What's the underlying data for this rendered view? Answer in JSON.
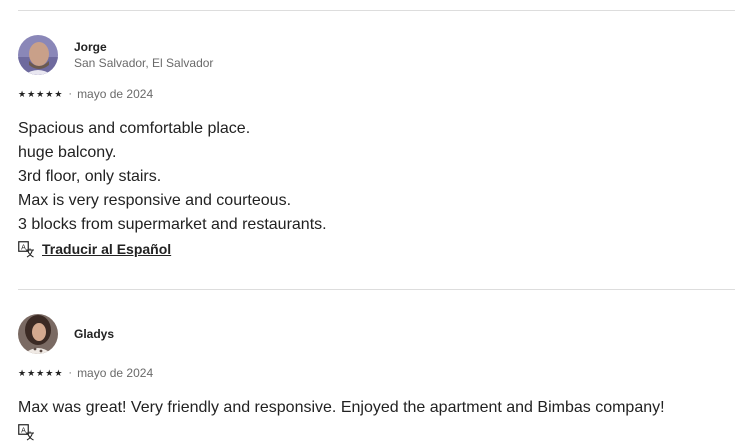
{
  "reviews": [
    {
      "name": "Jorge",
      "location": "San Salvador, El Salvador",
      "rating": 5,
      "separator": "·",
      "date": "mayo de 2024",
      "lines": [
        "Spacious and comfortable place.",
        "huge balcony.",
        "3rd floor, only stairs.",
        "Max is very responsive and courteous.",
        "3 blocks from supermarket and restaurants."
      ],
      "translate_label": "Traducir al Español",
      "translate_icon": "translate-icon"
    },
    {
      "name": "Gladys",
      "rating": 5,
      "separator": "·",
      "date": "mayo de 2024",
      "lines": [
        "Max was great! Very friendly and responsive. Enjoyed the apartment and Bimbas company!"
      ],
      "translate_icon": "translate-icon"
    }
  ],
  "star_icon": "star-icon",
  "star_glyph": "★"
}
